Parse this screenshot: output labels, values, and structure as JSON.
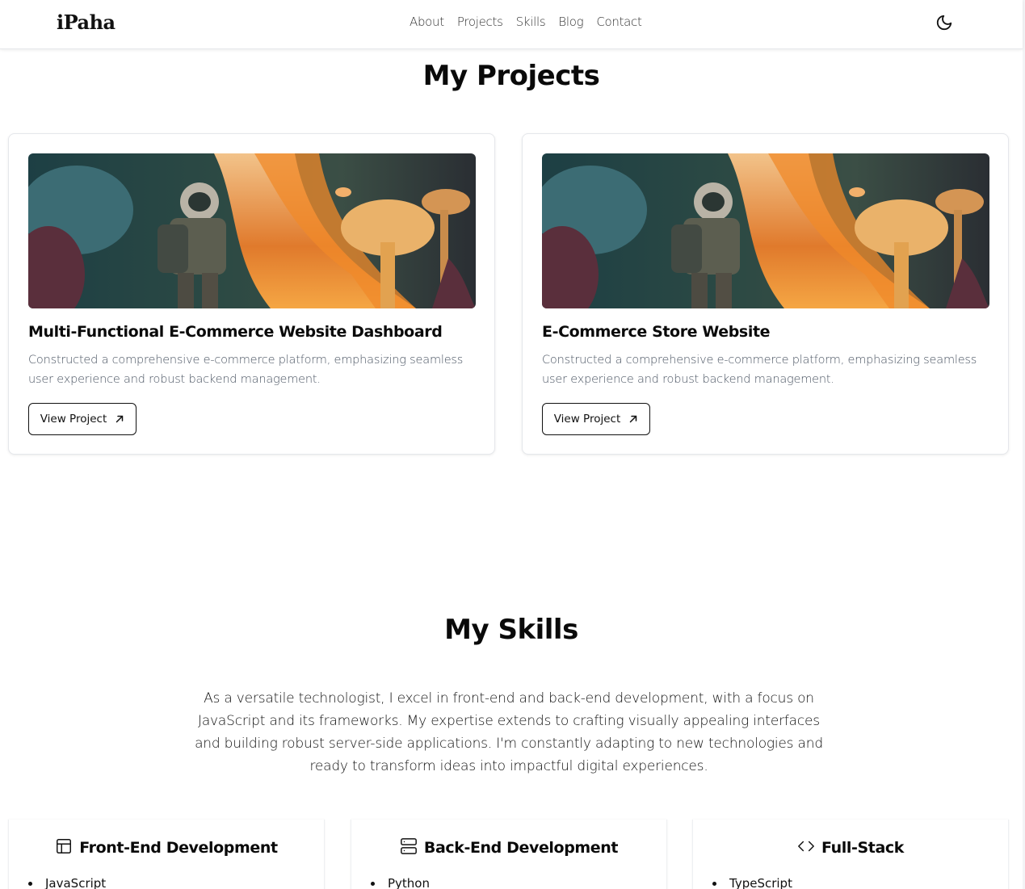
{
  "header": {
    "logo": "iPaha",
    "nav": [
      "About",
      "Projects",
      "Skills",
      "Blog",
      "Contact"
    ],
    "theme_icon": "moon-icon"
  },
  "projects": {
    "title": "My Projects",
    "cards": [
      {
        "title": "Multi-Functional E-Commerce Website Dashboard",
        "description": "Constructed a comprehensive e-commerce platform, emphasizing seamless user experience and robust backend management.",
        "button": "View Project",
        "button_icon": "arrow-up-right-icon",
        "image": "astronaut-mushroom-forest-image"
      },
      {
        "title": "E-Commerce Store Website",
        "description": "Constructed a comprehensive e-commerce platform, emphasizing seamless user experience and robust backend management.",
        "button": "View Project",
        "button_icon": "arrow-up-right-icon",
        "image": "astronaut-mushroom-forest-image"
      }
    ]
  },
  "skills": {
    "title": "My Skills",
    "description": "As a versatile technologist, I excel in front-end and back-end development, with a focus on JavaScript and its frameworks. My expertise extends to crafting visually appealing interfaces and building robust server-side applications. I'm constantly adapting to new technologies and ready to transform ideas into impactful digital experiences.",
    "cards": [
      {
        "icon": "layout-icon",
        "title": "Front-End Development",
        "items": [
          "JavaScript"
        ]
      },
      {
        "icon": "server-icon",
        "title": "Back-End Development",
        "items": [
          "Python"
        ]
      },
      {
        "icon": "code-icon",
        "title": "Full-Stack",
        "items": [
          "TypeScript"
        ]
      }
    ]
  },
  "colors": {
    "text": "#0a0a0a",
    "muted": "#4b5563",
    "border": "#e5e7eb",
    "background": "#ffffff"
  }
}
